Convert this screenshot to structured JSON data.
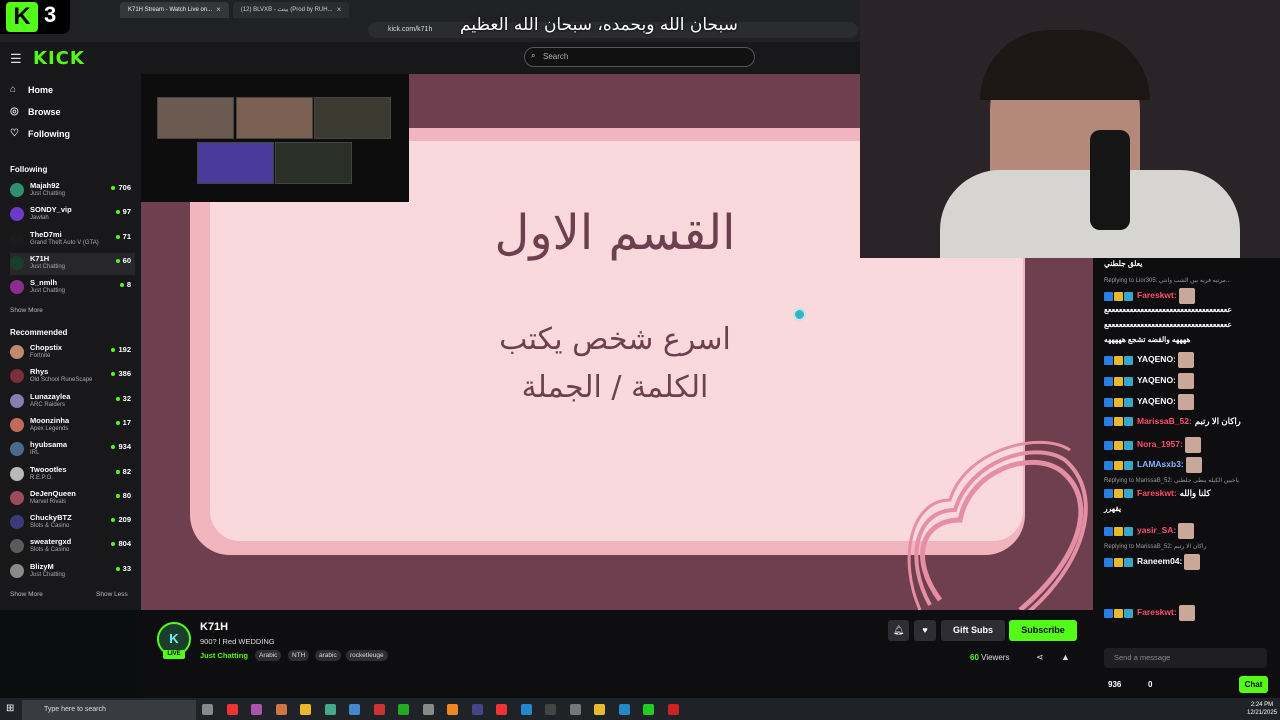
{
  "overlay": {
    "logo_k": "K",
    "logo_num": "3",
    "banner": "سبحان الله وبحمده، سبحان الله العظيم"
  },
  "browser": {
    "tabs": [
      {
        "label": "K71H Stream - Watch Live on..."
      },
      {
        "label": "(12) BLVXB - بيتث (Prod by RUH..."
      }
    ],
    "url": "kick.com/k71h"
  },
  "kick": {
    "logo": "KICK",
    "search_placeholder": "Search"
  },
  "sidebar": {
    "nav": [
      {
        "label": "Home",
        "icon": "home-icon"
      },
      {
        "label": "Browse",
        "icon": "compass-icon"
      },
      {
        "label": "Following",
        "icon": "heart-icon"
      }
    ],
    "following_header": "Following",
    "following": [
      {
        "name": "Majah92",
        "game": "Just Chatting",
        "viewers": "706",
        "color": "#2f8f6f"
      },
      {
        "name": "SONDY_vip",
        "game": "Jawlah",
        "viewers": "97",
        "color": "#6a39c7"
      },
      {
        "name": "TheD7mi",
        "game": "Grand Theft Auto V (GTA)",
        "viewers": "71",
        "color": "#1b1b1b"
      },
      {
        "name": "K71H",
        "game": "Just Chatting",
        "viewers": "60",
        "color": "#1b3d2c"
      },
      {
        "name": "S_nmlh",
        "game": "Just Chatting",
        "viewers": "8",
        "color": "#8a2c8f"
      }
    ],
    "show_more": "Show More",
    "recommended_header": "Recommended",
    "recommended": [
      {
        "name": "Chopstix",
        "game": "Fortnite",
        "viewers": "192",
        "color": "#c08a6a"
      },
      {
        "name": "Rhys",
        "game": "Old School RuneScape",
        "viewers": "386",
        "color": "#7a2e3a"
      },
      {
        "name": "Lunazaylea",
        "game": "ARC Raiders",
        "viewers": "32",
        "color": "#8a7bb0"
      },
      {
        "name": "Moonzinha",
        "game": "Apex Legends",
        "viewers": "17",
        "color": "#c06b58"
      },
      {
        "name": "hyubsama",
        "game": "IRL",
        "viewers": "934",
        "color": "#4a6a8a"
      },
      {
        "name": "Twoootles",
        "game": "R.E.P.O.",
        "viewers": "82",
        "color": "#b9b9b9"
      },
      {
        "name": "DeJenQueen",
        "game": "Marvel Rivals",
        "viewers": "80",
        "color": "#9a4b5a"
      },
      {
        "name": "ChuckyBTZ",
        "game": "Slots & Casino",
        "viewers": "209",
        "color": "#3a3a7a"
      },
      {
        "name": "sweatergxd",
        "game": "Slots & Casino",
        "viewers": "804",
        "color": "#5a5a5a"
      },
      {
        "name": "BlizyM",
        "game": "Just Chatting",
        "viewers": "33",
        "color": "#8a8a8a"
      }
    ],
    "show_more2": "Show More",
    "show_less": "Show Less"
  },
  "slide": {
    "title": "القسم الاول",
    "line1": "اسرع شخص يكتب",
    "line2": "الكلمة / الجملة"
  },
  "chat": {
    "messages": [
      {
        "type": "text",
        "text": "يعلق جلطني",
        "color": "#ffffff"
      },
      {
        "type": "reply",
        "text": "Replying to Lior305: مرتبه فريه بين الشب وانثي..."
      },
      {
        "type": "msg",
        "user": "Fareskwt:",
        "ucolor": "#ff4d6d",
        "text": ""
      },
      {
        "type": "text",
        "text": "ععععععععععععععععععععععععععععععععععع",
        "color": "#ffffff"
      },
      {
        "type": "text",
        "text": "ععععععععععععععععععععععععععععععععععع",
        "color": "#ffffff"
      },
      {
        "type": "text",
        "text": "ههههه والقضه تشجع هههههه",
        "color": "#ffffff"
      },
      {
        "type": "msg",
        "user": "YAQENO:",
        "ucolor": "#ffffff",
        "text": ""
      },
      {
        "type": "msg",
        "user": "YAQENO:",
        "ucolor": "#ffffff",
        "text": ""
      },
      {
        "type": "msg",
        "user": "YAQENO:",
        "ucolor": "#ffffff",
        "text": ""
      },
      {
        "type": "msg",
        "user": "MarissaB_52:",
        "ucolor": "#ff4d6d",
        "text": "راكان الا رتبم"
      },
      {
        "type": "msg",
        "user": "Nora_1957:",
        "ucolor": "#ff4d6d",
        "text": ""
      },
      {
        "type": "msg",
        "user": "LAMAsxb3:",
        "ucolor": "#7ab8ff",
        "text": ""
      },
      {
        "type": "reply",
        "text": "Replying to MarissaB_52: ياخيين الكيله يبطى جلطني"
      },
      {
        "type": "msg",
        "user": "Fareskwt:",
        "ucolor": "#ff4d6d",
        "text": "كلنا والله"
      },
      {
        "type": "text",
        "text": "يقهرر",
        "color": "#ffffff"
      },
      {
        "type": "msg",
        "user": "yasir_SA:",
        "ucolor": "#ff4d6d",
        "text": ""
      },
      {
        "type": "reply",
        "text": "Replying to MarissaB_52: راكان الا رتبم"
      },
      {
        "type": "msg",
        "user": "Raneem04:",
        "ucolor": "#ffffff",
        "text": ""
      },
      {
        "type": "msg",
        "user": "Fareskwt:",
        "ucolor": "#ff4d6d",
        "text": ""
      }
    ],
    "input_placeholder": "Send a message",
    "points": "936",
    "count": "0",
    "chat_button": "Chat"
  },
  "stream_info": {
    "avatar": "K",
    "live": "LIVE",
    "channel": "K71H",
    "title": "900? l Red WEDDING",
    "category": "Just Chatting",
    "tags": [
      "Arabic",
      "NTH",
      "arabic",
      "rocketleuge"
    ],
    "gift_subs": "Gift Subs",
    "subscribe": "Subscribe",
    "viewers_num": "60",
    "viewers_label": "Viewers"
  },
  "taskbar": {
    "search_placeholder": "Type here to search",
    "time": "2:24 PM",
    "date": "12/21/2025"
  },
  "colors": {
    "accent": "#53fc18",
    "slide_bg": "#6e3f4f",
    "slide_card": "#f9d9db"
  }
}
